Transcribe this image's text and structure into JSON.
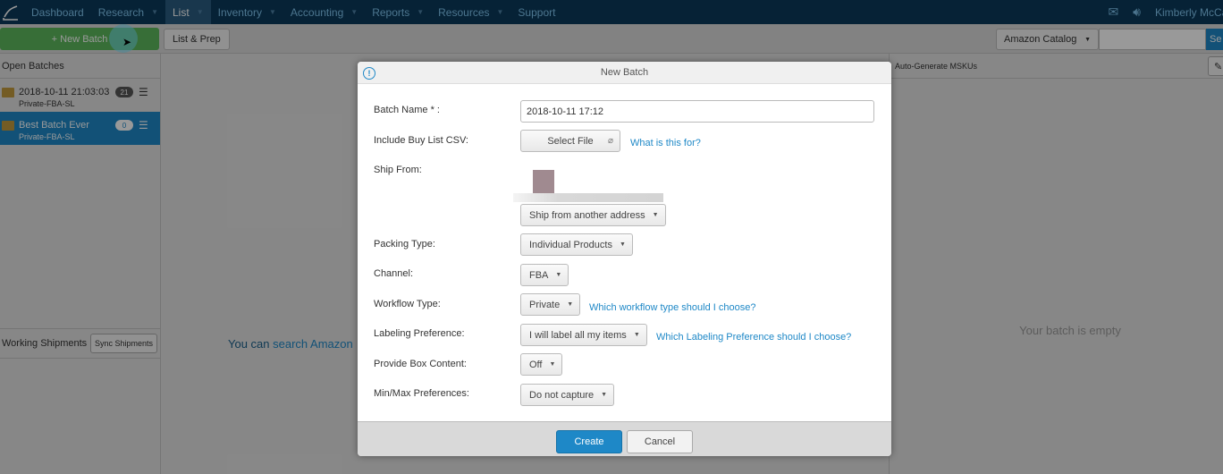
{
  "nav": {
    "items": [
      {
        "label": "Dashboard"
      },
      {
        "label": "Research"
      },
      {
        "label": "List"
      },
      {
        "label": "Inventory"
      },
      {
        "label": "Accounting"
      },
      {
        "label": "Reports"
      },
      {
        "label": "Resources"
      },
      {
        "label": "Support"
      }
    ],
    "user_name": "Kimberly McCaf"
  },
  "toolbar": {
    "new_batch_label": "+ New Batch",
    "list_prep_label": "List & Prep",
    "catalog_select_value": "Amazon Catalog",
    "search_label": "Se"
  },
  "sidebar": {
    "open_batches_label": "Open Batches",
    "batches": [
      {
        "name": "2018-10-11 21:03:03",
        "sub": "Private-FBA-SL",
        "count": "21"
      },
      {
        "name": "Best Batch Ever",
        "sub": "Private-FBA-SL",
        "count": "0"
      }
    ],
    "working_shipments_label": "Working Shipments",
    "sync_shipments_label": "Sync Shipments"
  },
  "main": {
    "message_prefix": "You can ",
    "message_link": "search Amazon"
  },
  "right_panel": {
    "auto_generate_label": "Auto-Generate MSKUs",
    "empty_text": "Your batch is empty"
  },
  "modal": {
    "title": "New Batch",
    "batch_name_label": "Batch Name * :",
    "batch_name_value": "2018-10-11 17:12",
    "buy_list_label": "Include Buy List CSV:",
    "select_file_label": "Select File",
    "buy_list_help": "What is this for?",
    "ship_from_label": "Ship From:",
    "ship_from_value": "Ship from another address",
    "packing_type_label": "Packing Type:",
    "packing_type_value": "Individual Products",
    "channel_label": "Channel:",
    "channel_value": "FBA",
    "workflow_label": "Workflow Type:",
    "workflow_value": "Private",
    "workflow_help": "Which workflow type should I choose?",
    "labeling_label": "Labeling Preference:",
    "labeling_value": "I will label all my items",
    "labeling_help": "Which Labeling Preference should I choose?",
    "box_content_label": "Provide Box Content:",
    "box_content_value": "Off",
    "minmax_label": "Min/Max Preferences:",
    "minmax_value": "Do not capture",
    "create_label": "Create",
    "cancel_label": "Cancel"
  }
}
